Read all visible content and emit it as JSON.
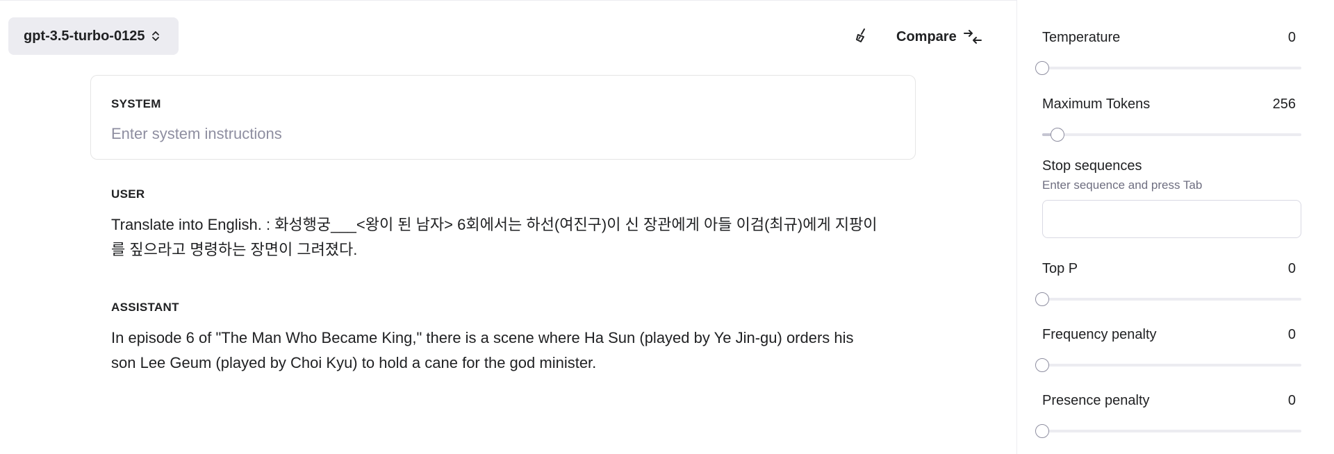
{
  "header": {
    "model": "gpt-3.5-turbo-0125",
    "compare_label": "Compare"
  },
  "messages": {
    "system": {
      "role": "SYSTEM",
      "placeholder": "Enter system instructions"
    },
    "user": {
      "role": "USER",
      "text": "Translate into English. : 화성행궁___<왕이 된 남자> 6회에서는 하선(여진구)이 신 장관에게 아들 이검(최규)에게 지팡이를 짚으라고 명령하는 장면이 그려졌다."
    },
    "assistant": {
      "role": "ASSISTANT",
      "text": "In episode 6 of \"The Man Who Became King,\" there is a scene where Ha Sun (played by Ye Jin-gu) orders his son Lee Geum (played by Choi Kyu) to hold a cane for the god minister."
    }
  },
  "params": {
    "temperature": {
      "label": "Temperature",
      "value": "0",
      "fraction": 0
    },
    "max_tokens": {
      "label": "Maximum Tokens",
      "value": "256",
      "fraction": 0.06
    },
    "stop_sequences": {
      "label": "Stop sequences",
      "hint": "Enter sequence and press Tab"
    },
    "top_p": {
      "label": "Top P",
      "value": "0",
      "fraction": 0
    },
    "frequency_penalty": {
      "label": "Frequency penalty",
      "value": "0",
      "fraction": 0
    },
    "presence_penalty": {
      "label": "Presence penalty",
      "value": "0",
      "fraction": 0
    }
  }
}
